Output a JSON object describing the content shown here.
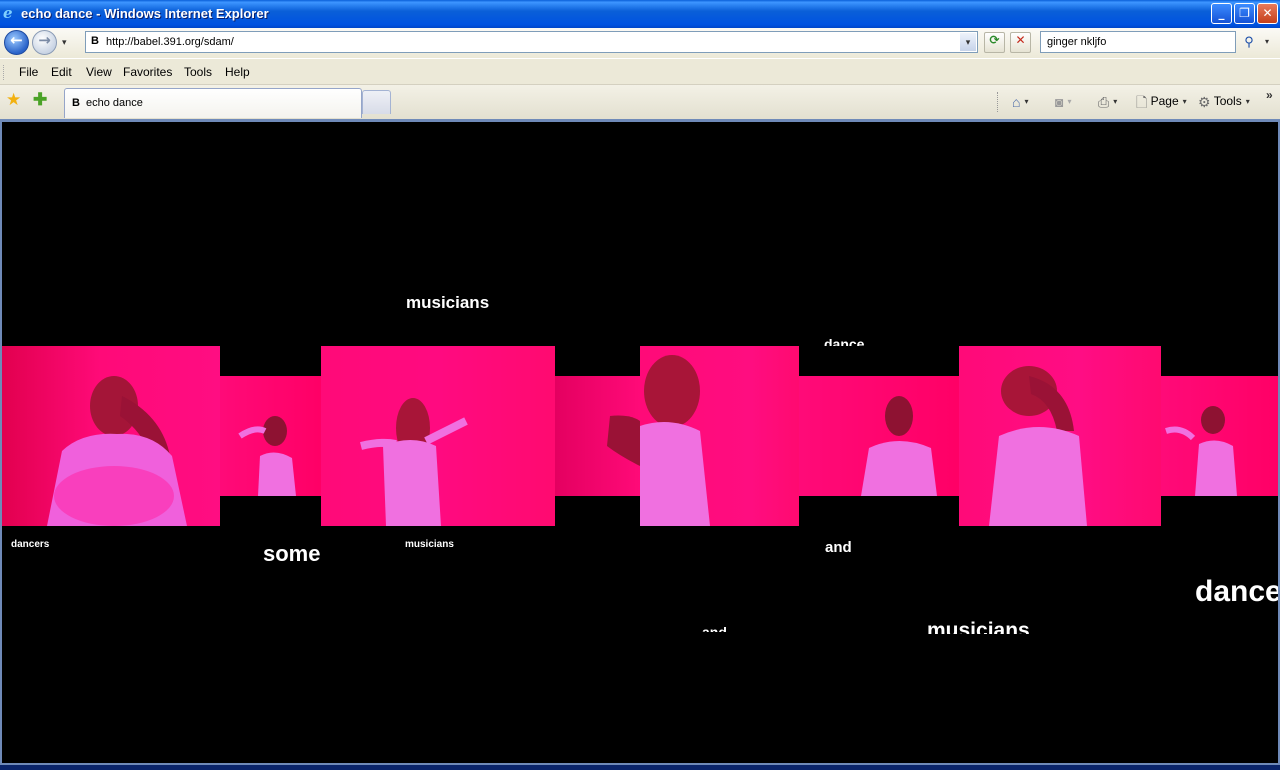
{
  "window": {
    "title": "echo dance - Windows Internet Explorer",
    "minimize_glyph": "_",
    "restore_glyph": "❐",
    "close_glyph": "✕"
  },
  "address_bar": {
    "back_glyph": "←",
    "forward_glyph": "→",
    "history_glyph": "▾",
    "favicon": "B",
    "url": "http://babel.391.org/sdam/",
    "dropdown_glyph": "▾",
    "refresh_glyph": "⟳",
    "stop_glyph": "✕",
    "search_value": "ginger nkljfo",
    "search_glyph": "⚲",
    "search_dropdown_glyph": "▾"
  },
  "menu": {
    "items": [
      "File",
      "Edit",
      "View",
      "Favorites",
      "Tools",
      "Help"
    ]
  },
  "tabs": {
    "favorites_glyph": "★",
    "add_favorite_glyph": "✚",
    "active_tab": {
      "icon": "B",
      "label": "echo dance"
    },
    "chevron_glyph": "»"
  },
  "command_bar": {
    "home_glyph": "⌂",
    "feeds_glyph": "◙",
    "print_glyph": "⎙",
    "page_glyph": "🗋",
    "page_label": "Page",
    "tools_glyph": "⚙",
    "tools_label": "Tools",
    "dropdown_glyph": "▾"
  },
  "page": {
    "background": "#000000",
    "frame_colors": {
      "hot_pink": "#ff0a78",
      "deep_pink": "#e8005c",
      "magenta_shirt": "#f070e0",
      "hair": "#8a1020"
    },
    "words": [
      "musicians",
      "dance",
      "dancers",
      "some",
      "musicians",
      "and",
      "dance",
      "and",
      "musicians"
    ]
  }
}
